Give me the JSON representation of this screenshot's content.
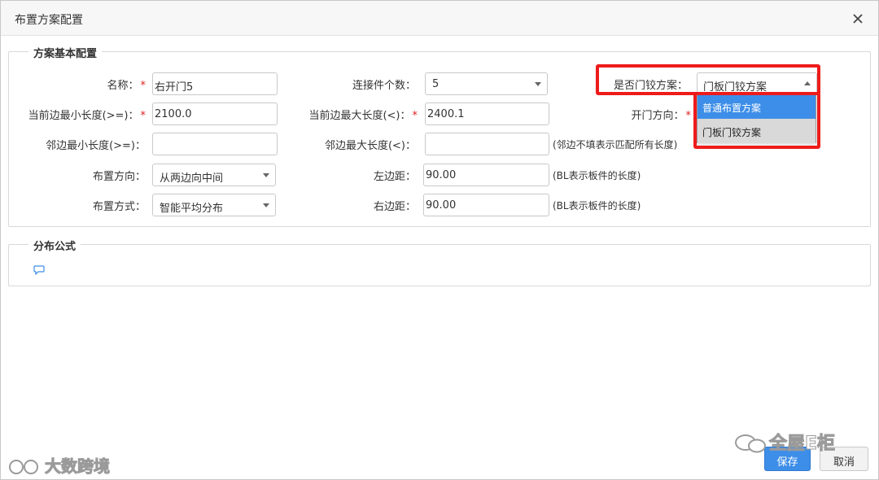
{
  "dialog": {
    "title": "布置方案配置"
  },
  "basic": {
    "legend": "方案基本配置",
    "name": {
      "label": "名称：",
      "value": "右开门5"
    },
    "connector_count": {
      "label": "连接件个数：",
      "value": "5"
    },
    "hinge_scheme": {
      "label": "是否门铰方案：",
      "value": "门板门铰方案",
      "options": [
        "普通布置方案",
        "门板门铰方案"
      ]
    },
    "cur_min_len": {
      "label": "当前边最小长度(>=)：",
      "value": "2100.0"
    },
    "cur_max_len": {
      "label": "当前边最大长度(<)：",
      "value": "2400.1"
    },
    "open_dir": {
      "label": "开门方向："
    },
    "adj_min_len": {
      "label": "邻边最小长度(>=)：",
      "value": ""
    },
    "adj_max_len": {
      "label": "邻边最大长度(<)：",
      "value": ""
    },
    "adj_hint": "(邻边不填表示匹配所有长度)",
    "layout_dir": {
      "label": "布置方向：",
      "value": "从两边向中间"
    },
    "left_margin": {
      "label": "左边距：",
      "value": "90.00"
    },
    "left_hint": "(BL表示板件的长度)",
    "layout_mode": {
      "label": "布置方式：",
      "value": "智能平均分布"
    },
    "right_margin": {
      "label": "右边距：",
      "value": "90.00"
    },
    "right_hint": "(BL表示板件的长度)"
  },
  "formula": {
    "legend": "分布公式",
    "icon": "comment-icon"
  },
  "buttons": {
    "save": "保存",
    "cancel": "取消"
  },
  "watermarks": {
    "left": "大数跨境",
    "right": "全屋E柜"
  },
  "colors": {
    "accent": "#3d8ee8",
    "required": "#e02020",
    "highlight": "#ee1b1b"
  }
}
